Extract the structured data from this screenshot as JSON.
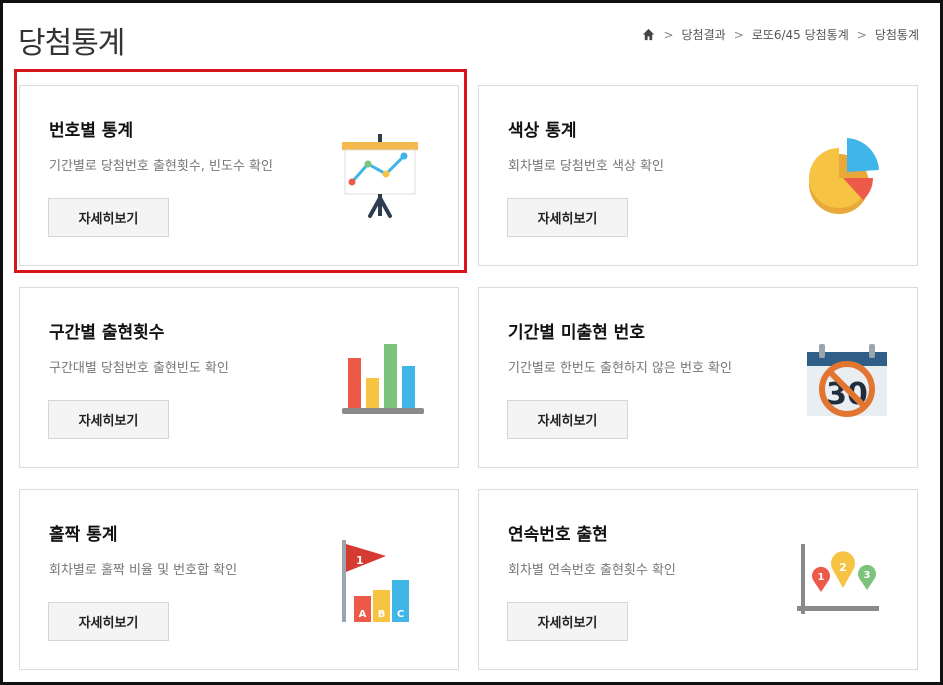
{
  "page": {
    "title": "당첨통계"
  },
  "breadcrumb": {
    "items": [
      "당첨결과",
      "로또6/45 당첨통계",
      "당첨통계"
    ]
  },
  "cards": [
    {
      "title": "번호별 통계",
      "desc": "기간별로 당첨번호 출현횟수, 빈도수 확인",
      "button": "자세히보기",
      "icon": "presentation-chart-icon"
    },
    {
      "title": "색상 통계",
      "desc": "회차별로 당첨번호 색상 확인",
      "button": "자세히보기",
      "icon": "pie-chart-icon"
    },
    {
      "title": "구간별 출현횟수",
      "desc": "구간대별 당첨번호 출현빈도 확인",
      "button": "자세히보기",
      "icon": "bar-chart-icon"
    },
    {
      "title": "기간별 미출현 번호",
      "desc": "기간별로 한번도 출현하지 않은 번호 확인",
      "button": "자세히보기",
      "icon": "calendar-prohibited-icon"
    },
    {
      "title": "홀짝 통계",
      "desc": "회차별로 홀짝 비율 및 번호합 확인",
      "button": "자세히보기",
      "icon": "flag-abc-blocks-icon"
    },
    {
      "title": "연속번호 출현",
      "desc": "회차별 연속번호 출현횟수 확인",
      "button": "자세히보기",
      "icon": "map-pins-chart-icon"
    }
  ],
  "icon_labels": {
    "calendar_number": "30",
    "flag_number": "1",
    "blocks": [
      "A",
      "B",
      "C"
    ],
    "pins": [
      "1",
      "2",
      "3"
    ]
  },
  "colors": {
    "highlight": "#d6161b",
    "red": "#ee5a4a",
    "yellow": "#f6c342",
    "green": "#7cc47b",
    "blue": "#3fb5e8"
  }
}
